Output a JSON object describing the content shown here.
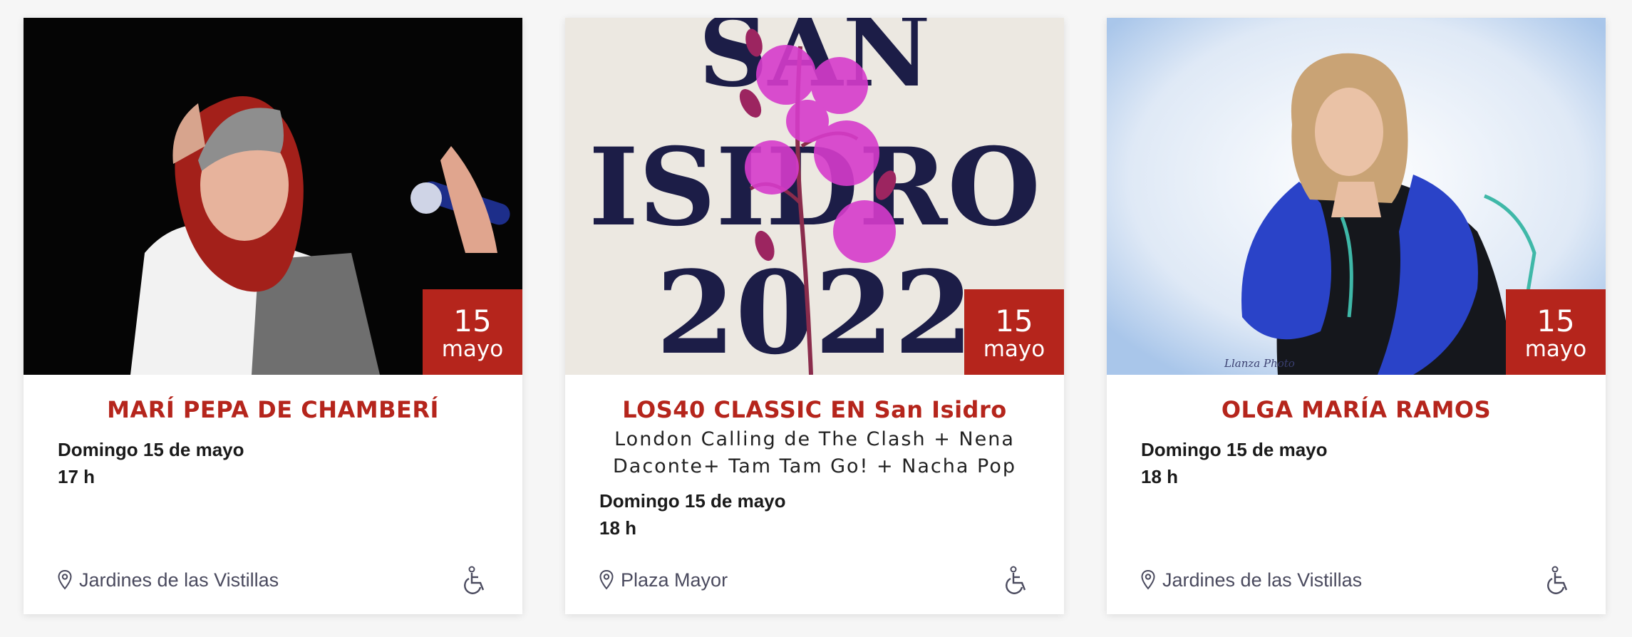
{
  "cards": [
    {
      "day": "15",
      "month": "mayo",
      "title": "MARÍ PEPA DE CHAMBERÍ",
      "subtitle": "",
      "date_line": "Domingo 15 de mayo",
      "time_line": "17 h",
      "venue": "Jardines de las Vistillas",
      "location_icon": "location-pin-icon",
      "access_icon": "wheelchair-accessible-icon"
    },
    {
      "day": "15",
      "month": "mayo",
      "title": "LOS40 CLASSIC EN San Isidro",
      "subtitle": "London Calling de The Clash + Nena Daconte+ Tam Tam Go! + Nacha Pop",
      "date_line": "Domingo 15 de mayo",
      "time_line": "18 h",
      "venue": "Plaza Mayor",
      "location_icon": "location-pin-icon",
      "access_icon": "wheelchair-accessible-icon",
      "poster": {
        "line1": "SAN",
        "line2": "ISIDRO",
        "line3": "2022"
      }
    },
    {
      "day": "15",
      "month": "mayo",
      "title": "OLGA MARÍA RAMOS",
      "subtitle": "",
      "date_line": "Domingo 15 de mayo",
      "time_line": "18 h",
      "venue": "Jardines de las Vistillas",
      "location_icon": "location-pin-icon",
      "access_icon": "wheelchair-accessible-icon",
      "watermark": "Llanza Photo"
    }
  ],
  "colors": {
    "accent": "#b5251c",
    "poster_ink": "#1c1d47",
    "poster_flower": "#d63ccb",
    "venue_text": "#4a4a5e"
  }
}
